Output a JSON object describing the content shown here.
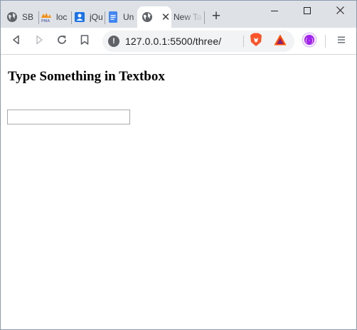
{
  "browser": {
    "tabs": [
      {
        "label": "SB",
        "icon": "globe-icon"
      },
      {
        "label": "loc",
        "icon": "phpmyadmin-icon"
      },
      {
        "label": "jQu",
        "icon": "contacts-icon"
      },
      {
        "label": "Un",
        "icon": "docs-icon"
      },
      {
        "label": "",
        "icon": "globe-icon",
        "active": true
      },
      {
        "label": "New Ta",
        "icon": ""
      }
    ],
    "new_tab_label": "+",
    "close_tab_label": "✕",
    "address": "127.0.0.1:5500/three/",
    "info_glyph": "!",
    "controls": {
      "minimize": "minimize-icon",
      "maximize": "maximize-icon",
      "close": "close-icon"
    },
    "colors": {
      "tabstrip": "#dee1e6",
      "brave": "#fb542b",
      "bat": "#662d91",
      "extension": "#a020f0"
    }
  },
  "page": {
    "heading": "Type Something in Textbox",
    "textbox_value": ""
  }
}
